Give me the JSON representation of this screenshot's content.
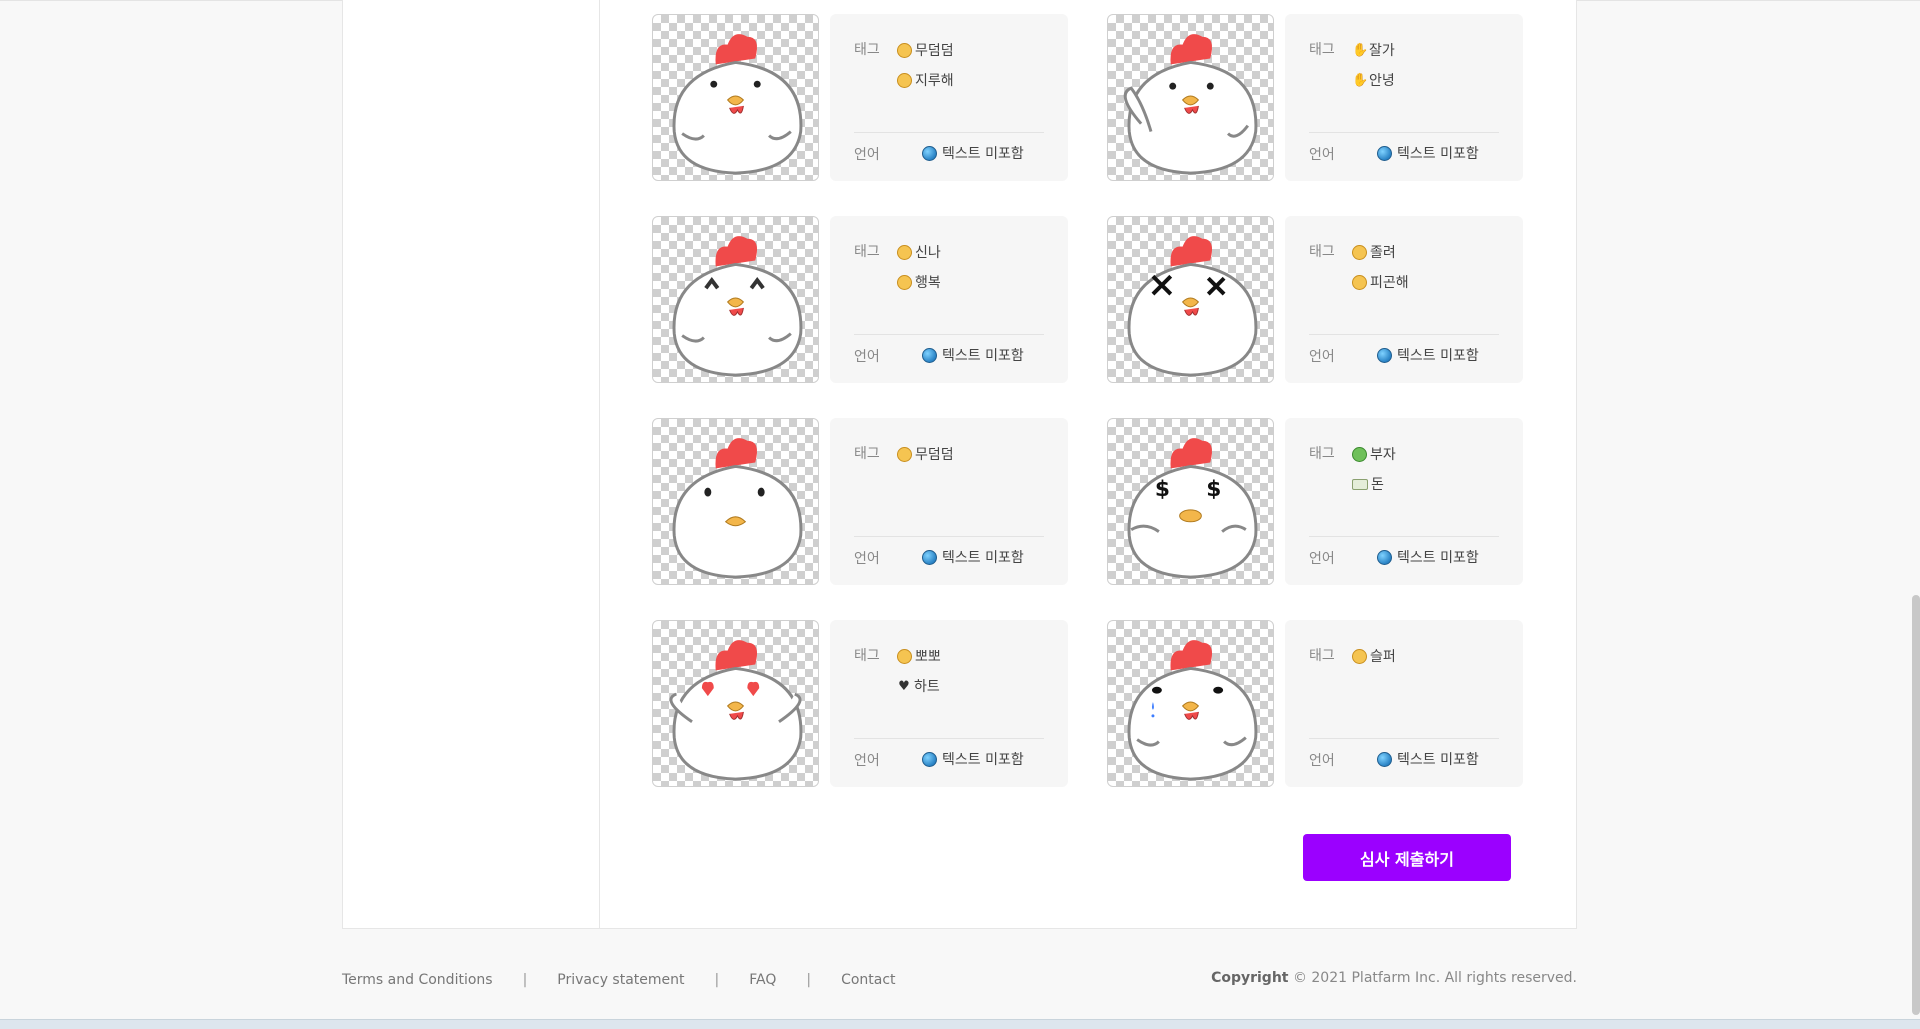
{
  "labels": {
    "tag": "태그",
    "language": "언어"
  },
  "language_value": "텍스트 미포함",
  "cards": [
    {
      "face": "neutral",
      "tags": [
        {
          "icon": "neutral-face-icon",
          "text": "무덤덤"
        },
        {
          "icon": "expressionless-face-icon",
          "text": "지루해"
        }
      ]
    },
    {
      "face": "wave",
      "tags": [
        {
          "icon": "raised-hand-icon",
          "text": "잘가"
        },
        {
          "icon": "waving-hand-icon",
          "text": "안녕"
        }
      ]
    },
    {
      "face": "happy",
      "tags": [
        {
          "icon": "grinning-squint-face-icon",
          "text": "신나"
        },
        {
          "icon": "smiling-face-icon",
          "text": "행복"
        }
      ]
    },
    {
      "face": "dizzy",
      "tags": [
        {
          "icon": "sleepy-face-icon",
          "text": "졸려"
        },
        {
          "icon": "tired-face-icon",
          "text": "피곤해"
        }
      ]
    },
    {
      "face": "plain",
      "tags": [
        {
          "icon": "neutral-face-icon",
          "text": "무덤덤"
        }
      ]
    },
    {
      "face": "money",
      "tags": [
        {
          "icon": "money-mouth-face-icon",
          "text": "부자"
        },
        {
          "icon": "banknote-icon",
          "text": "돈"
        }
      ]
    },
    {
      "face": "love",
      "tags": [
        {
          "icon": "kissing-face-icon",
          "text": "뽀뽀"
        },
        {
          "icon": "black-heart-icon",
          "text": "하트"
        }
      ]
    },
    {
      "face": "sad",
      "tags": [
        {
          "icon": "sad-face-icon",
          "text": "슬퍼"
        }
      ]
    }
  ],
  "submit_label": "심사 제출하기",
  "footer": {
    "links": [
      "Terms and Conditions",
      "Privacy statement",
      "FAQ",
      "Contact"
    ],
    "copyright_brand": "Copyright",
    "copyright_text": "© 2021 Platfarm Inc. All rights reserved."
  },
  "colors": {
    "accent": "#9b00ff",
    "comb": "#f04a4a",
    "beak": "#f3b64a"
  }
}
